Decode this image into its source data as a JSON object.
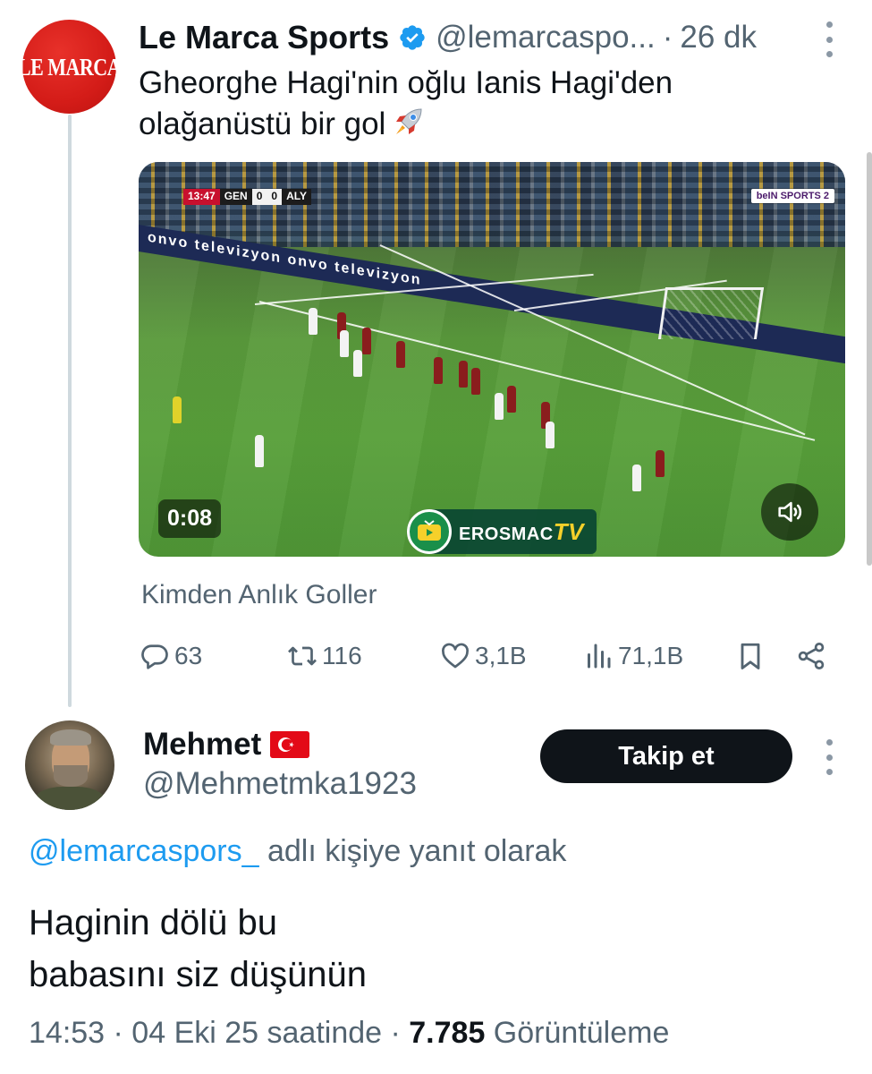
{
  "parent_tweet": {
    "avatar_text": "LE MARCA",
    "display_name": "Le Marca Sports",
    "handle": "@lemarcaspo...",
    "separator": "·",
    "time": "26 dk",
    "text_line1": "Gheorghe Hagi'nin oğlu Ianis Hagi'den",
    "text_line2": "olağanüstü bir gol",
    "video": {
      "timer": "0:08",
      "scorebug": {
        "clock": "13:47",
        "home": "GEN",
        "home_score": "0",
        "away_score": "0",
        "away": "ALY"
      },
      "channel_badge": "beIN SPORTS 2",
      "ad_boards": "onvo televizyon onvo televizyon",
      "watermark_brand": "EROSMAC",
      "watermark_suffix": "TV"
    },
    "source": "Kimden  Anlık Goller",
    "actions": {
      "replies": "63",
      "reposts": "116",
      "likes": "3,1B",
      "views": "71,1B"
    }
  },
  "reply_tweet": {
    "display_name": "Mehmet",
    "handle": "@Mehmetmka1923",
    "follow_label": "Takip et",
    "reply_to_mention": "@lemarcaspors_",
    "reply_to_suffix": " adlı kişiye yanıt olarak",
    "text_line1": "Haginin dölü bu",
    "text_line2": "babasını siz düşünün",
    "meta_time": "14:53 · 04 Eki 25 saatinde · ",
    "meta_views": "7.785",
    "meta_views_label": " Görüntüleme"
  },
  "colors": {
    "text_primary": "#0f1419",
    "text_secondary": "#536471",
    "link": "#1d9bf0",
    "verified": "#1d9bf0",
    "brand_red": "#d41c18",
    "follow_bg": "#0f1419"
  }
}
